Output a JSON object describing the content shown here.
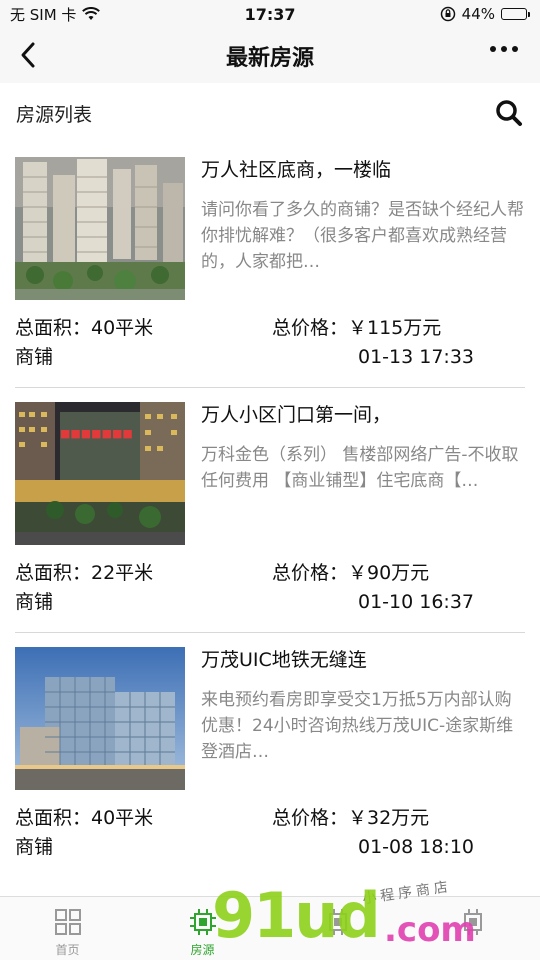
{
  "status": {
    "carrier": "无 SIM 卡",
    "time": "17:37",
    "battery_text": "44%",
    "battery_level": 0.44
  },
  "nav": {
    "title": "最新房源"
  },
  "section": {
    "title": "房源列表"
  },
  "listings": [
    {
      "title": "万人社区底商，一楼临",
      "desc": "请问你看了多久的商铺？是否缺个经纪人帮你排忧解难？（很多客户都喜欢成熟经营的，人家都把…",
      "area": "总面积：40平米",
      "price": "总价格：￥115万元",
      "type": "商铺",
      "date": "01-13 17:33"
    },
    {
      "title": "万人小区门口第一间，",
      "desc": "万科金色（系列） 售楼部网络广告-不收取任何费用 【商业铺型】住宅底商【…",
      "area": "总面积：22平米",
      "price": "总价格：￥90万元",
      "type": "商铺",
      "date": "01-10 16:37"
    },
    {
      "title": "万茂UIC地铁无缝连",
      "desc": "来电预约看房即享受交1万抵5万内部认购优惠！24小时咨询热线万茂UIC-途家斯维登酒店…",
      "area": "总面积：40平米",
      "price": "总价格：￥32万元",
      "type": "商铺",
      "date": "01-08 18:10"
    }
  ],
  "tabs": [
    {
      "label": "首页",
      "icon": "grid-icon"
    },
    {
      "label": "房源",
      "icon": "chip-icon",
      "active": true
    },
    {
      "label": "",
      "icon": "chip-icon"
    },
    {
      "label": "",
      "icon": "chip-icon"
    }
  ],
  "watermark": {
    "main": "91ud",
    "suffix": ".com",
    "small": "小程序商店"
  },
  "colors": {
    "accent": "#2fa52f",
    "watermark_green": "#8fd11b",
    "watermark_pink": "#e040b0"
  }
}
